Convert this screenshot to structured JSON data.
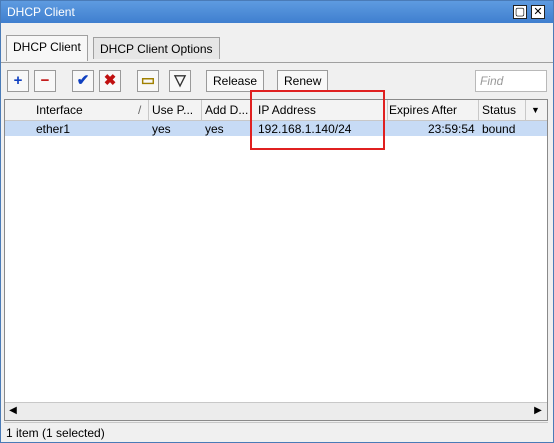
{
  "window": {
    "title": "DHCP Client"
  },
  "tabs": [
    {
      "label": "DHCP Client"
    },
    {
      "label": "DHCP Client Options"
    }
  ],
  "toolbar": {
    "release_label": "Release",
    "renew_label": "Renew",
    "find_placeholder": "Find",
    "add_icon": "+",
    "remove_icon": "−",
    "enable_icon": "✔",
    "disable_icon": "✖",
    "comment_icon": "▭",
    "filter_icon": "▽"
  },
  "table": {
    "columns": [
      "Interface",
      "Use P...",
      "Add D...",
      "IP Address",
      "Expires After",
      "Status"
    ],
    "rows": [
      {
        "interface": "ether1",
        "use_peer_dns": "yes",
        "add_default_route": "yes",
        "ip_address": "192.168.1.140/24",
        "expires_after": "23:59:54",
        "status": "bound"
      }
    ]
  },
  "status_text": "1 item (1 selected)",
  "colors": {
    "titlebar": "#4f8fd8",
    "selected_row": "#c7dbf5",
    "highlight": "#e02020"
  }
}
